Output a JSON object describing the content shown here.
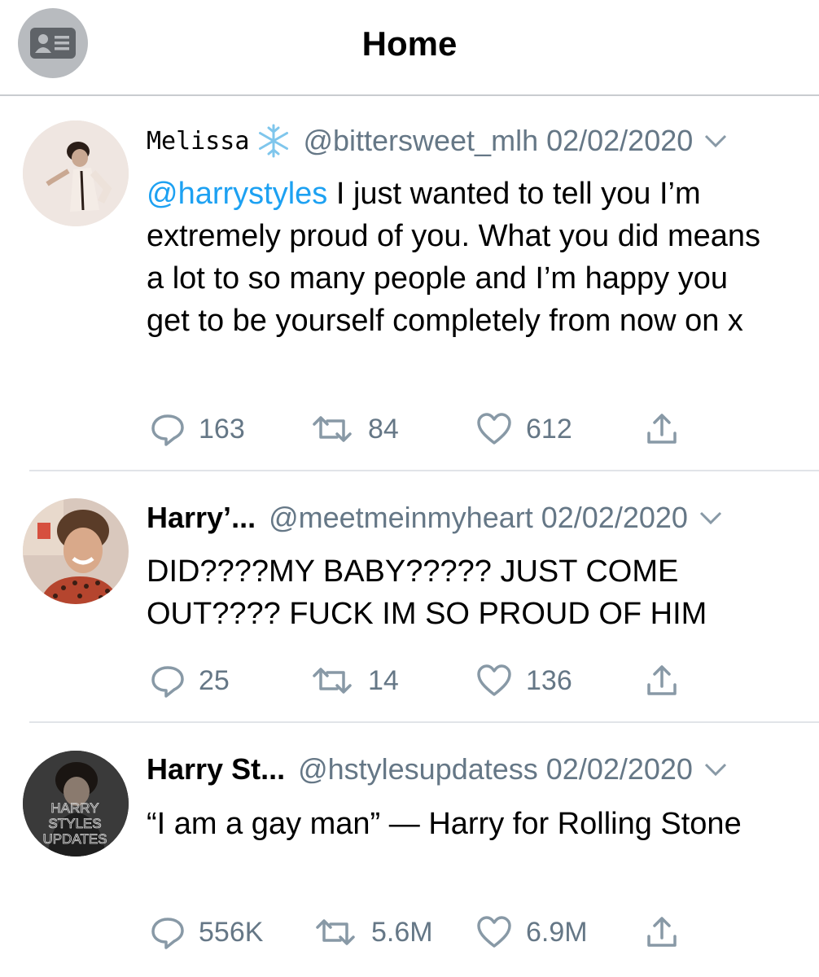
{
  "header": {
    "title": "Home",
    "profile_icon": "contact-card-icon"
  },
  "colors": {
    "link": "#1da1f2",
    "muted": "#657786",
    "divider": "#e1e4e8"
  },
  "tweets": [
    {
      "name": "Melissa",
      "name_emoji": "snowflake-icon",
      "handle": "@bittersweet_mlh",
      "date": "02/02/2020",
      "mention": "@harrystyles",
      "text": " I just wanted to tell you I’m extremely proud of you. What you did means a lot to so many people and I’m happy you get to be yourself completely from now on x",
      "replies": "163",
      "retweets": "84",
      "likes": "612"
    },
    {
      "name": "Harry’...",
      "handle": "@meetmeinmyheart",
      "date": "02/02/2020",
      "text": "DID????MY BABY????? JUST COME OUT???? FUCK IM SO PROUD OF HIM",
      "replies": "25",
      "retweets": "14",
      "likes": "136"
    },
    {
      "name": "Harry St...",
      "handle": "@hstylesupdatess",
      "date": "02/02/2020",
      "avatar_text": [
        "HARRY",
        "STYLES",
        "UPDATES"
      ],
      "text": "“I am a gay man” — Harry for Rolling Stone",
      "replies": "556K",
      "retweets": "5.6M",
      "likes": "6.9M"
    }
  ]
}
